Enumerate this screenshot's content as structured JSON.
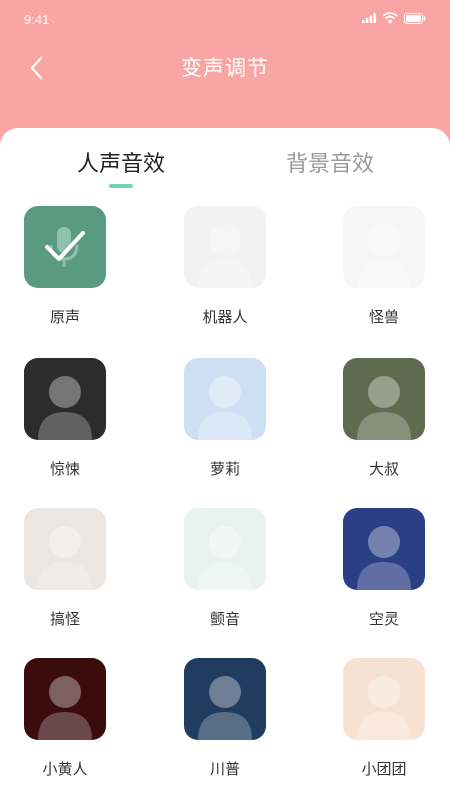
{
  "status": {
    "time": "9:41"
  },
  "nav": {
    "title": "变声调节"
  },
  "tabs": [
    {
      "label": "人声音效",
      "active": true
    },
    {
      "label": "背景音效",
      "active": false
    }
  ],
  "effects": [
    {
      "label": "原声",
      "icon": "microphone-check-icon",
      "selected": true,
      "color": "#5a9a82"
    },
    {
      "label": "机器人",
      "icon": "robot-astronaut-image",
      "color": "#f2f2f2"
    },
    {
      "label": "怪兽",
      "icon": "monster-image",
      "color": "#f6f6f6"
    },
    {
      "label": "惊悚",
      "icon": "horror-girl-image",
      "color": "#2c2c2c"
    },
    {
      "label": "萝莉",
      "icon": "anime-girl-image",
      "color": "#cfe0f4"
    },
    {
      "label": "大叔",
      "icon": "old-man-image",
      "color": "#5e6b4f"
    },
    {
      "label": "搞怪",
      "icon": "laughing-girl-image",
      "color": "#e9e6e4"
    },
    {
      "label": "颤音",
      "icon": "fan-girl-image",
      "color": "#e8f3ef"
    },
    {
      "label": "空灵",
      "icon": "night-sky-image",
      "color": "#2a3f86"
    },
    {
      "label": "小黄人",
      "icon": "minion-image",
      "color": "#3b0c0c"
    },
    {
      "label": "川普",
      "icon": "trump-poster-image",
      "color": "#203c5e"
    },
    {
      "label": "小团团",
      "icon": "crying-anime-image",
      "color": "#f7e1d2"
    }
  ]
}
